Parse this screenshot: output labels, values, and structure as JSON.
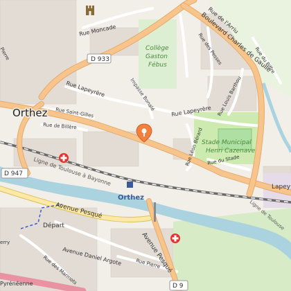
{
  "map": {
    "town": "Orthez",
    "station": "Orthez",
    "labels": {
      "rue_moncade": "Rue Moncade",
      "rue_arriu": "Rue de l'Arriu",
      "boulevard": "Boulevard Charles de Gaulle",
      "rue_des_pesses": "Rue des Pesses",
      "rue_du_piffre": "Rue du Piffre",
      "college": [
        "Collège",
        "Gaston",
        "Fébus"
      ],
      "impasse": "Impasse Bonalé",
      "rue_lapeyrere_w": "Rue Lapeyrère",
      "rue_lapeyrere_e": "Rue Lapeyrère",
      "rue_saint_gilles": "Rue Saint-Gilles",
      "rue_de_billere": "Rue de Billère",
      "rue_louis_barthou": "Rue Louis Barthou",
      "stade": [
        "Stade Municipal",
        "Henri Cazenave"
      ],
      "rue_leon_berard": "Rue Léon Bérard",
      "rue_du_stade": "Rue du Stade",
      "rail_line": "Ligne de Toulouse à Bayonne",
      "rail_line_e": "Ligne de Toulouse",
      "lapeyr": "Lapeyr",
      "avenue_pesque": "Avenue Pesqué",
      "avenue_pesque_s": "Avenue Pesqué",
      "depart": "Départ",
      "avenue_daniel_argote": "Avenue Daniel Argote",
      "rue_des_marmots": "Rue des Marmots",
      "rue_pierre": "Rue Pierre",
      "pyreneenne": "Pyrénéenne",
      "pierre_nw": "Pierre",
      "erry": "erry"
    },
    "shields": {
      "d933": "D 933",
      "d947": "D 947",
      "d9": "D 9"
    },
    "icons": [
      "castle-icon",
      "hospital-icon",
      "location-pin-icon",
      "railway-station-icon"
    ],
    "colors": {
      "background": "#f2efe9",
      "major_road": "#f7c58c",
      "secondary_road": "#fde8a6",
      "water": "#aad3df",
      "school": "#c9e6c0",
      "park": "#cdebb0",
      "hospital": "#e5322d",
      "pin": "#f27f3d",
      "rail": "#6a6a6a"
    }
  }
}
